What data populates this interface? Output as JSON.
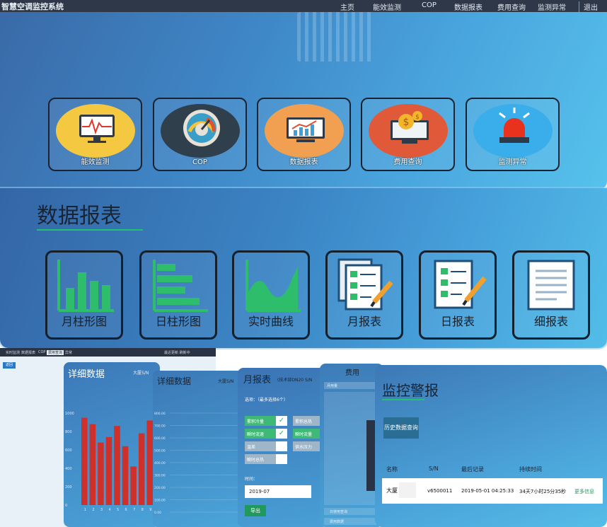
{
  "app": {
    "title": "智慧空调监控系统"
  },
  "nav": {
    "items": [
      "主页",
      "能效监测",
      "COP",
      "数据报表",
      "费用查询",
      "监测异常"
    ],
    "exit": "退出"
  },
  "hero": {
    "tiles": [
      {
        "label": "能效监测",
        "icon": "monitor-pulse-icon",
        "color": "#f5c842"
      },
      {
        "label": "COP",
        "icon": "gauge-icon",
        "color": "#2f3f4c"
      },
      {
        "label": "数据报表",
        "icon": "chart-monitor-icon",
        "color": "#f0a050"
      },
      {
        "label": "费用查询",
        "icon": "money-monitor-icon",
        "color": "#e05a3a"
      },
      {
        "label": "监测异常",
        "icon": "alarm-light-icon",
        "color": "#3aaeea"
      }
    ]
  },
  "report": {
    "title": "数据报表",
    "tiles": [
      "月柱形图",
      "日柱形图",
      "实时曲线",
      "月报表",
      "日报表",
      "细报表"
    ]
  },
  "panels": {
    "p1": {
      "tabs": [
        "实时监测",
        "数据报表",
        "COP",
        "费用查询",
        "异常"
      ],
      "right": "最近更新 刷新中",
      "back": "返回"
    },
    "p2": {
      "title": "详细数据",
      "sub": "大厦S/N",
      "bar_values": [
        95,
        88,
        68,
        74,
        86,
        64,
        42,
        78,
        92
      ],
      "yticks": [
        "1000",
        "800",
        "600",
        "400",
        "200",
        "0"
      ],
      "xticks": [
        "1",
        "2",
        "3",
        "4",
        "5",
        "6",
        "7",
        "8",
        "9"
      ]
    },
    "p3": {
      "title": "详细数据",
      "sub": "大厦S/N",
      "yticks": [
        "800.00",
        "700.00",
        "600.00",
        "500.00",
        "400.00",
        "300.00",
        "200.00",
        "100.00",
        "0.00"
      ]
    },
    "p4": {
      "title": "月报表",
      "sub": "(技术部DN20 S/N",
      "hint": "选项：（最多选择6个）",
      "options": [
        {
          "label": "累积冷量",
          "checked": true
        },
        {
          "label": "累积总热",
          "checked": false
        },
        {
          "label": "瞬时流速",
          "checked": true
        },
        {
          "label": "瞬时流量",
          "checked": false
        },
        {
          "label": "温差",
          "checked": false
        },
        {
          "label": "供水压力",
          "checked": false
        },
        {
          "label": "瞬时总热",
          "checked": false
        }
      ],
      "time_label": "时间：",
      "time_value": "2019-07",
      "export": "导出"
    },
    "p5": {
      "title": "费用",
      "menu": [
        "月用量",
        "日使用查询",
        "费用数据"
      ]
    },
    "p6": {
      "title": "监控警报",
      "history_btn": "历史数据查询",
      "columns": [
        "名称",
        "S/N",
        "最后记录",
        "持续时间"
      ],
      "row": {
        "name": "大厦",
        "sn": "v6500011",
        "last": "2019-05-01 04:25:33",
        "duration": "34天7小时25分35秒",
        "more": "更多信息"
      }
    }
  }
}
